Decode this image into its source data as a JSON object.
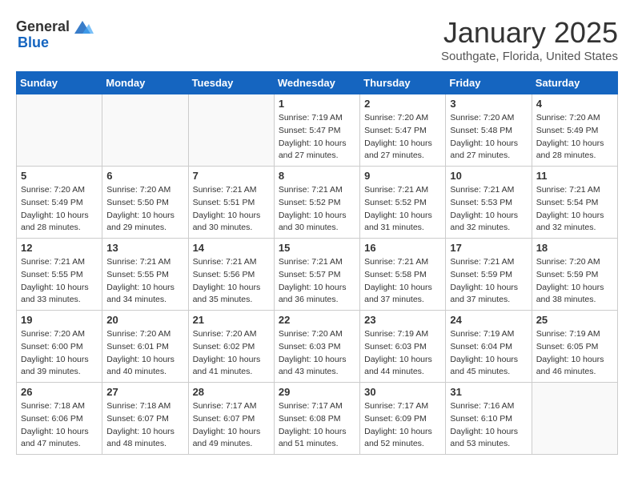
{
  "header": {
    "logo_general": "General",
    "logo_blue": "Blue",
    "title": "January 2025",
    "subtitle": "Southgate, Florida, United States"
  },
  "days_of_week": [
    "Sunday",
    "Monday",
    "Tuesday",
    "Wednesday",
    "Thursday",
    "Friday",
    "Saturday"
  ],
  "weeks": [
    [
      {
        "day": "",
        "info": ""
      },
      {
        "day": "",
        "info": ""
      },
      {
        "day": "",
        "info": ""
      },
      {
        "day": "1",
        "info": "Sunrise: 7:19 AM\nSunset: 5:47 PM\nDaylight: 10 hours\nand 27 minutes."
      },
      {
        "day": "2",
        "info": "Sunrise: 7:20 AM\nSunset: 5:47 PM\nDaylight: 10 hours\nand 27 minutes."
      },
      {
        "day": "3",
        "info": "Sunrise: 7:20 AM\nSunset: 5:48 PM\nDaylight: 10 hours\nand 27 minutes."
      },
      {
        "day": "4",
        "info": "Sunrise: 7:20 AM\nSunset: 5:49 PM\nDaylight: 10 hours\nand 28 minutes."
      }
    ],
    [
      {
        "day": "5",
        "info": "Sunrise: 7:20 AM\nSunset: 5:49 PM\nDaylight: 10 hours\nand 28 minutes."
      },
      {
        "day": "6",
        "info": "Sunrise: 7:20 AM\nSunset: 5:50 PM\nDaylight: 10 hours\nand 29 minutes."
      },
      {
        "day": "7",
        "info": "Sunrise: 7:21 AM\nSunset: 5:51 PM\nDaylight: 10 hours\nand 30 minutes."
      },
      {
        "day": "8",
        "info": "Sunrise: 7:21 AM\nSunset: 5:52 PM\nDaylight: 10 hours\nand 30 minutes."
      },
      {
        "day": "9",
        "info": "Sunrise: 7:21 AM\nSunset: 5:52 PM\nDaylight: 10 hours\nand 31 minutes."
      },
      {
        "day": "10",
        "info": "Sunrise: 7:21 AM\nSunset: 5:53 PM\nDaylight: 10 hours\nand 32 minutes."
      },
      {
        "day": "11",
        "info": "Sunrise: 7:21 AM\nSunset: 5:54 PM\nDaylight: 10 hours\nand 32 minutes."
      }
    ],
    [
      {
        "day": "12",
        "info": "Sunrise: 7:21 AM\nSunset: 5:55 PM\nDaylight: 10 hours\nand 33 minutes."
      },
      {
        "day": "13",
        "info": "Sunrise: 7:21 AM\nSunset: 5:55 PM\nDaylight: 10 hours\nand 34 minutes."
      },
      {
        "day": "14",
        "info": "Sunrise: 7:21 AM\nSunset: 5:56 PM\nDaylight: 10 hours\nand 35 minutes."
      },
      {
        "day": "15",
        "info": "Sunrise: 7:21 AM\nSunset: 5:57 PM\nDaylight: 10 hours\nand 36 minutes."
      },
      {
        "day": "16",
        "info": "Sunrise: 7:21 AM\nSunset: 5:58 PM\nDaylight: 10 hours\nand 37 minutes."
      },
      {
        "day": "17",
        "info": "Sunrise: 7:21 AM\nSunset: 5:59 PM\nDaylight: 10 hours\nand 37 minutes."
      },
      {
        "day": "18",
        "info": "Sunrise: 7:20 AM\nSunset: 5:59 PM\nDaylight: 10 hours\nand 38 minutes."
      }
    ],
    [
      {
        "day": "19",
        "info": "Sunrise: 7:20 AM\nSunset: 6:00 PM\nDaylight: 10 hours\nand 39 minutes."
      },
      {
        "day": "20",
        "info": "Sunrise: 7:20 AM\nSunset: 6:01 PM\nDaylight: 10 hours\nand 40 minutes."
      },
      {
        "day": "21",
        "info": "Sunrise: 7:20 AM\nSunset: 6:02 PM\nDaylight: 10 hours\nand 41 minutes."
      },
      {
        "day": "22",
        "info": "Sunrise: 7:20 AM\nSunset: 6:03 PM\nDaylight: 10 hours\nand 43 minutes."
      },
      {
        "day": "23",
        "info": "Sunrise: 7:19 AM\nSunset: 6:03 PM\nDaylight: 10 hours\nand 44 minutes."
      },
      {
        "day": "24",
        "info": "Sunrise: 7:19 AM\nSunset: 6:04 PM\nDaylight: 10 hours\nand 45 minutes."
      },
      {
        "day": "25",
        "info": "Sunrise: 7:19 AM\nSunset: 6:05 PM\nDaylight: 10 hours\nand 46 minutes."
      }
    ],
    [
      {
        "day": "26",
        "info": "Sunrise: 7:18 AM\nSunset: 6:06 PM\nDaylight: 10 hours\nand 47 minutes."
      },
      {
        "day": "27",
        "info": "Sunrise: 7:18 AM\nSunset: 6:07 PM\nDaylight: 10 hours\nand 48 minutes."
      },
      {
        "day": "28",
        "info": "Sunrise: 7:17 AM\nSunset: 6:07 PM\nDaylight: 10 hours\nand 49 minutes."
      },
      {
        "day": "29",
        "info": "Sunrise: 7:17 AM\nSunset: 6:08 PM\nDaylight: 10 hours\nand 51 minutes."
      },
      {
        "day": "30",
        "info": "Sunrise: 7:17 AM\nSunset: 6:09 PM\nDaylight: 10 hours\nand 52 minutes."
      },
      {
        "day": "31",
        "info": "Sunrise: 7:16 AM\nSunset: 6:10 PM\nDaylight: 10 hours\nand 53 minutes."
      },
      {
        "day": "",
        "info": ""
      }
    ]
  ]
}
